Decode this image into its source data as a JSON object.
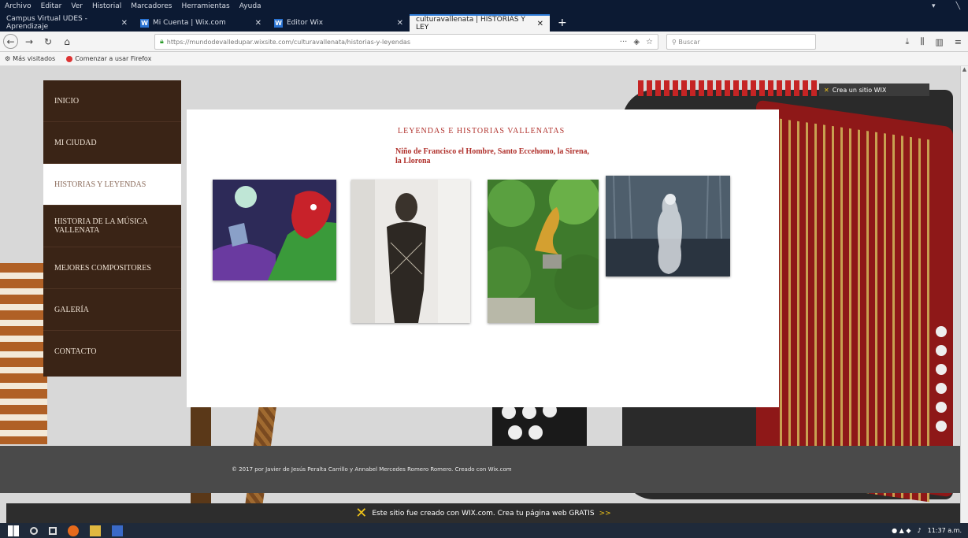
{
  "menubar": [
    "Archivo",
    "Editar",
    "Ver",
    "Historial",
    "Marcadores",
    "Herramientas",
    "Ayuda"
  ],
  "tabs": [
    {
      "label": "Campus Virtual UDES - Aprendizaje",
      "icon": "campus-icon"
    },
    {
      "label": "Mi Cuenta | Wix.com",
      "icon": "wix-icon"
    },
    {
      "label": "Editor Wix",
      "icon": "wix-icon"
    },
    {
      "label": "culturavallenata | HISTORIAS Y LEY",
      "icon": "page-icon",
      "active": true
    }
  ],
  "url": "https://mundodevalledupar.wixsite.com/culturavallenata/historias-y-leyendas",
  "search_placeholder": "Buscar",
  "bookmarks": [
    "Más visitados",
    "Comenzar a usar Firefox"
  ],
  "wix_badge": "Crea un sitio WIX",
  "menu": [
    {
      "label": "INICIO"
    },
    {
      "label": "MI CIUDAD"
    },
    {
      "label": "HISTORIAS Y LEYENDAS",
      "active": true
    },
    {
      "label": "HISTORIA DE LA MÚSICA VALLENATA"
    },
    {
      "label": "MEJORES COMPOSITORES"
    },
    {
      "label": "GALERÍA"
    },
    {
      "label": "CONTACTO"
    }
  ],
  "content": {
    "title": "LEYENDAS E HISTORIAS VALLENATAS",
    "subtitle": "Niño de Francisco el Hombre, Santo Eccehomo, la Sirena, la Llorona"
  },
  "gallery": [
    {
      "name": "francisco-el-hombre-image"
    },
    {
      "name": "santo-eccehomo-image"
    },
    {
      "name": "sirena-image"
    },
    {
      "name": "llorona-image"
    }
  ],
  "footer_text": "© 2017 por Javier de Jesús Peralta Carrillo y Annabel Mercedes Romero Romero. Creado con Wix.com",
  "wix_banner": "Este sitio fue creado con WIX.com. Crea tu página web GRATIS",
  "wix_banner_arrow": ">>",
  "clock": "11:37 a.m.",
  "colors": {
    "menu_bg": "#3a2416",
    "accent_red": "#b0312c",
    "footer_bg": "#4a4a4a",
    "wix_yellow": "#f0c419"
  }
}
